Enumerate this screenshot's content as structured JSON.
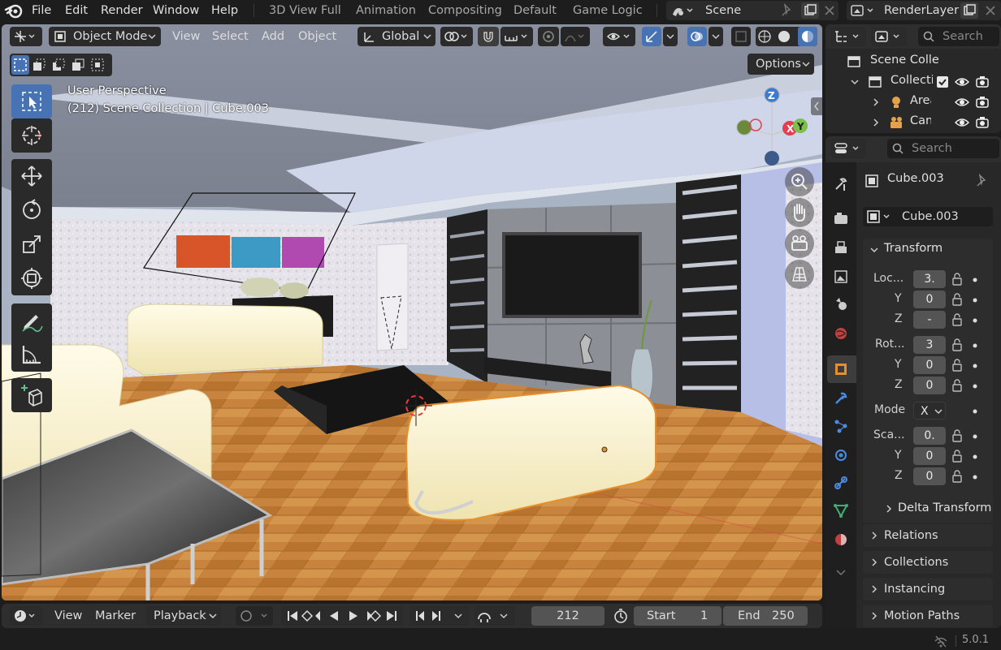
{
  "topbar": {
    "menus": [
      "File",
      "Edit",
      "Render",
      "Window",
      "Help"
    ],
    "workspaces": [
      "3D View Full",
      "Animation",
      "Compositing",
      "Default",
      "Game Logic"
    ],
    "scene_name": "Scene",
    "render_layer": "RenderLayer"
  },
  "viewport": {
    "mode": "Object Mode",
    "menus": [
      "View",
      "Select",
      "Add",
      "Object"
    ],
    "transform_orientation": "Global",
    "options_label": "Options",
    "perspective_label": "User Perspective",
    "context_label": "(212) Scene Collection | Cube.003",
    "gizmo_axes": {
      "z": "Z",
      "x": "X",
      "y": "Y"
    }
  },
  "outliner": {
    "search_placeholder": "Search",
    "scene_collection": "Scene Colle",
    "items": [
      {
        "label": "Collecti",
        "type": "collection"
      },
      {
        "label": "Area",
        "type": "light"
      },
      {
        "label": "Can",
        "type": "camera"
      }
    ]
  },
  "properties": {
    "search_placeholder": "Search",
    "object_name": "Cube.003",
    "data_name": "Cube.003",
    "transform": {
      "title": "Transform",
      "location_label": "Loc...",
      "location": [
        "3.",
        "0",
        "-"
      ],
      "rotation_label": "Rot...",
      "rotation": [
        "3",
        "0",
        "0"
      ],
      "mode_label": "Mode",
      "mode_value": "X",
      "scale_label": "Sca...",
      "scale": [
        "0.",
        "0",
        "0"
      ],
      "axis_labels": [
        "Y",
        "Z"
      ],
      "delta_label": "Delta Transform"
    },
    "panels": [
      "Relations",
      "Collections",
      "Instancing",
      "Motion Paths"
    ]
  },
  "timeline": {
    "menus": [
      "View",
      "Marker"
    ],
    "playback_label": "Playback",
    "current_frame": "212",
    "start_label": "Start",
    "start_value": "1",
    "end_label": "End",
    "end_value": "250"
  },
  "statusbar": {
    "version": "5.0.1"
  },
  "colors": {
    "accent_blue": "#4772b3",
    "selection_orange": "#e5902c",
    "axis_x": "#e0404f",
    "axis_y": "#7ac04a",
    "axis_z": "#3c7bd4"
  }
}
